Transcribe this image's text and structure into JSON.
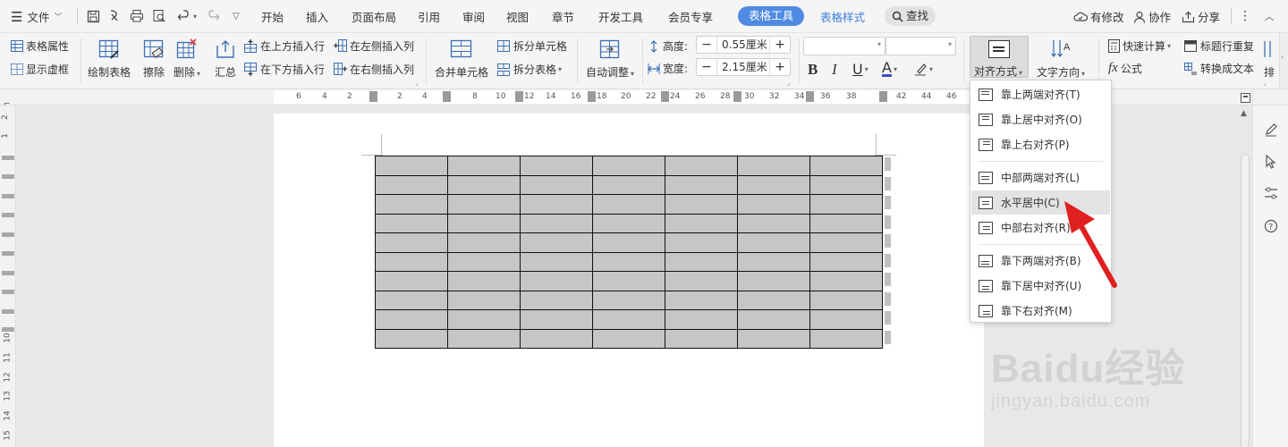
{
  "topbar": {
    "file_menu": "文件",
    "tabs": [
      "开始",
      "插入",
      "页面布局",
      "引用",
      "审阅",
      "视图",
      "章节",
      "开发工具",
      "会员专享"
    ],
    "active_tab": "表格工具",
    "table_style_tab": "表格样式",
    "search": "查找",
    "modified": "有修改",
    "collaborate": "协作",
    "share": "分享"
  },
  "ribbon": {
    "table_props": "表格属性",
    "show_gridlines": "显示虚框",
    "draw_table": "绘制表格",
    "erase": "擦除",
    "delete": "删除",
    "summary": "汇总",
    "insert_row_above": "在上方插入行",
    "insert_row_below": "在下方插入行",
    "insert_col_left": "在左侧插入列",
    "insert_col_right": "在右侧插入列",
    "merge_cells": "合并单元格",
    "split_cells": "拆分单元格",
    "split_table": "拆分表格",
    "auto_fit": "自动调整",
    "height_label": "高度:",
    "height_value": "0.55厘米",
    "width_label": "宽度:",
    "width_value": "2.15厘米",
    "bold": "B",
    "italic": "I",
    "underline": "U",
    "font_color": "A",
    "align": "对齐方式",
    "text_direction": "文字方向",
    "quick_calc": "快速计算",
    "formula": "公式",
    "repeat_header": "标题行重复",
    "convert_text": "转换成文本",
    "sort_partial": "排"
  },
  "ruler": {
    "h_labels": [
      "6",
      "4",
      "2",
      "2",
      "4",
      "8",
      "10",
      "12",
      "14",
      "16",
      "18",
      "20",
      "22",
      "24",
      "26",
      "28",
      "30",
      "32",
      "34",
      "36",
      "38",
      "42",
      "44",
      "46"
    ],
    "v_labels": [
      "2",
      "1",
      "10",
      "11",
      "12",
      "13",
      "14",
      "15"
    ]
  },
  "align_menu": {
    "items": [
      "靠上两端对齐(T)",
      "靠上居中对齐(O)",
      "靠上右对齐(P)",
      "中部两端对齐(L)",
      "水平居中(C)",
      "中部右对齐(R)",
      "靠下两端对齐(B)",
      "靠下居中对齐(U)",
      "靠下右对齐(M)"
    ],
    "highlighted_index": 4
  },
  "table": {
    "rows": 10,
    "cols": 7
  },
  "watermark": {
    "brand": "Baidu经验",
    "url": "jingyan.baidu.com"
  },
  "colors": {
    "accent": "#4f8be3",
    "arrow": "#e02020",
    "cell_fill": "#c6c6c6"
  }
}
